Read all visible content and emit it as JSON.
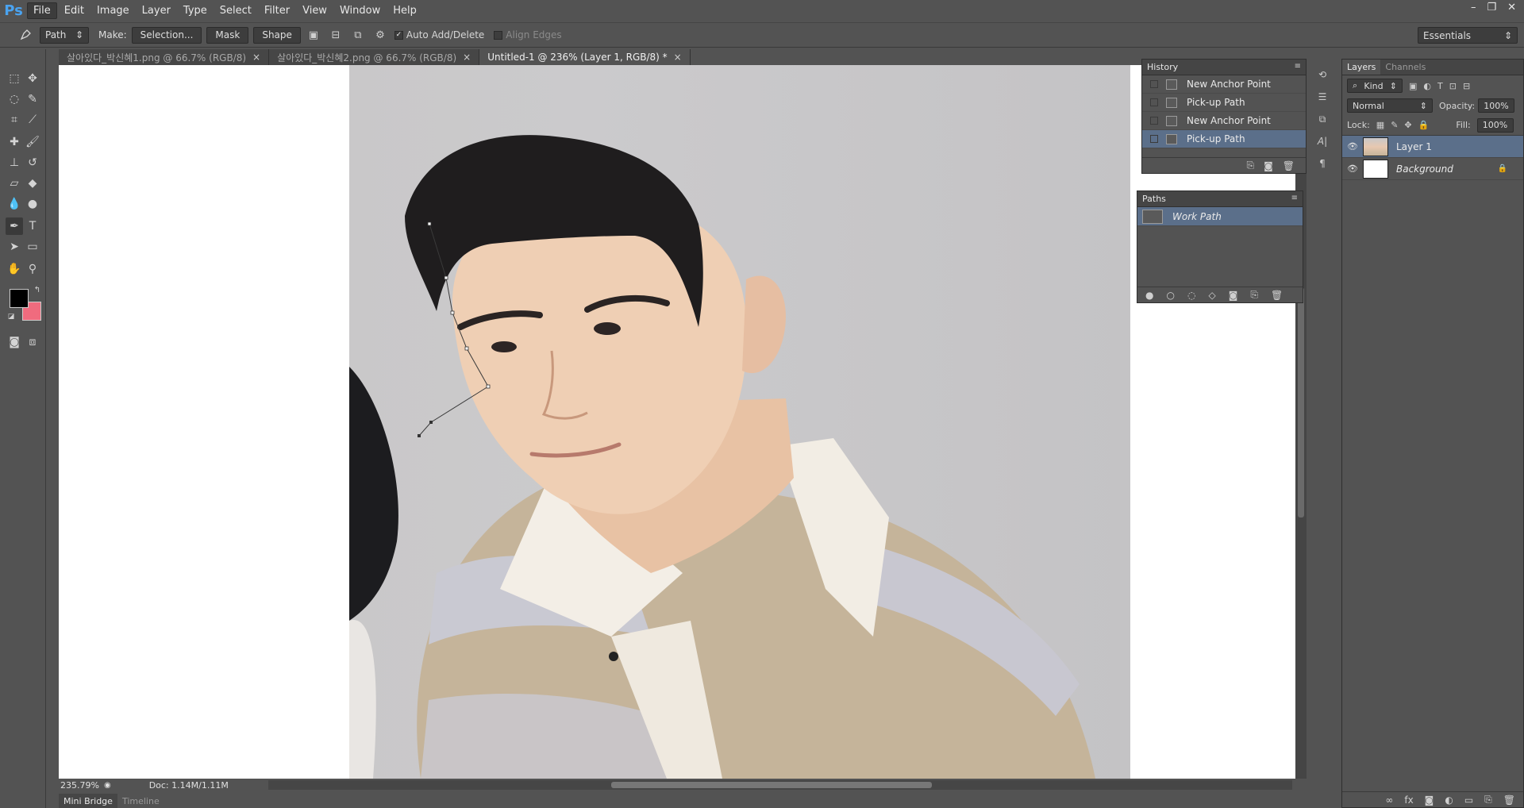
{
  "app": {
    "logo": "Ps"
  },
  "menu": [
    "File",
    "Edit",
    "Image",
    "Layer",
    "Type",
    "Select",
    "Filter",
    "View",
    "Window",
    "Help"
  ],
  "window_controls": {
    "minimize": "–",
    "restore": "❐",
    "close": "✕"
  },
  "options": {
    "mode": "Path",
    "make_label": "Make:",
    "selection_btn": "Selection...",
    "mask_btn": "Mask",
    "shape_btn": "Shape",
    "auto_add_delete": "Auto Add/Delete",
    "auto_add_checked": "✓",
    "align_edges": "Align Edges",
    "workspace": "Essentials"
  },
  "tabs": [
    {
      "label": "살아있다_박신혜1.png @ 66.7% (RGB/8)",
      "close": "×"
    },
    {
      "label": "살아있다_박신혜2.png @ 66.7% (RGB/8)",
      "close": "×"
    },
    {
      "label": "Untitled-1 @ 236% (Layer 1, RGB/8) *",
      "close": "×"
    }
  ],
  "status": {
    "zoom": "235.79%",
    "doc": "Doc: 1.14M/1.11M"
  },
  "bottom_tabs": [
    "Mini Bridge",
    "Timeline"
  ],
  "history": {
    "title": "History",
    "items": [
      "New Anchor Point",
      "Pick-up Path",
      "New Anchor Point",
      "Pick-up Path"
    ]
  },
  "paths": {
    "title": "Paths",
    "items": [
      "Work Path"
    ]
  },
  "layers": {
    "tabs": [
      "Layers",
      "Channels"
    ],
    "kind": "Kind",
    "blend_mode": "Normal",
    "opacity_label": "Opacity:",
    "opacity": "100%",
    "lock_label": "Lock:",
    "fill_label": "Fill:",
    "fill": "100%",
    "items": [
      "Layer 1",
      "Background"
    ]
  },
  "colors": {
    "foreground": "#000000",
    "background": "#f06b7e",
    "selection": "#5b6f8a",
    "logo": "#4aa3f0"
  }
}
